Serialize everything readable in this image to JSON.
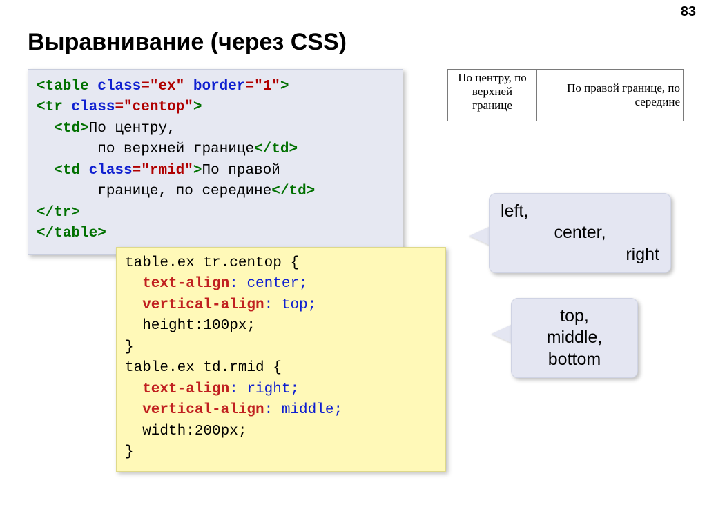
{
  "page_number": "83",
  "title": "Выравнивание (через CSS)",
  "html_code": {
    "l1": {
      "a": "<table",
      "b": " class",
      "c": "=\"ex\"",
      "d": " border",
      "e": "=\"1\"",
      "f": ">"
    },
    "l2": {
      "a": "<tr",
      "b": " class",
      "c": "=\"centop\"",
      "d": ">"
    },
    "l3": {
      "a": "  <td>",
      "b": "По центру,"
    },
    "l4": "       по верхней границе</td>",
    "l4text": "       по верхней границе",
    "l4end": "</td>",
    "l5": {
      "a": "  <td",
      "b": " class",
      "c": "=\"rmid\"",
      "d": ">",
      "e": "По правой"
    },
    "l6text": "       границе, по середине",
    "l6end": "</td>",
    "l7": "</tr>",
    "l8": "</table>"
  },
  "css_code": {
    "r1": "table.ex tr.centop {",
    "r2p": "  text-align",
    "r2v": ": center;",
    "r3p": "  vertical-align",
    "r3v": ": top;",
    "r4": "  height:100px;",
    "r5": "}",
    "r6": "table.ex td.rmid {",
    "r7p": "  text-align",
    "r7v": ": right;",
    "r8p": "  vertical-align",
    "r8v": ": middle;",
    "r9": "  width:200px;",
    "r10": "}"
  },
  "example": {
    "cell1": "По центру, по верхней границе",
    "cell2": "По правой границе, по середине"
  },
  "callout1": {
    "l1": "left,",
    "l2": "center,",
    "l3": "right"
  },
  "callout2": {
    "l1": "top,",
    "l2": "middle,",
    "l3": "bottom"
  }
}
